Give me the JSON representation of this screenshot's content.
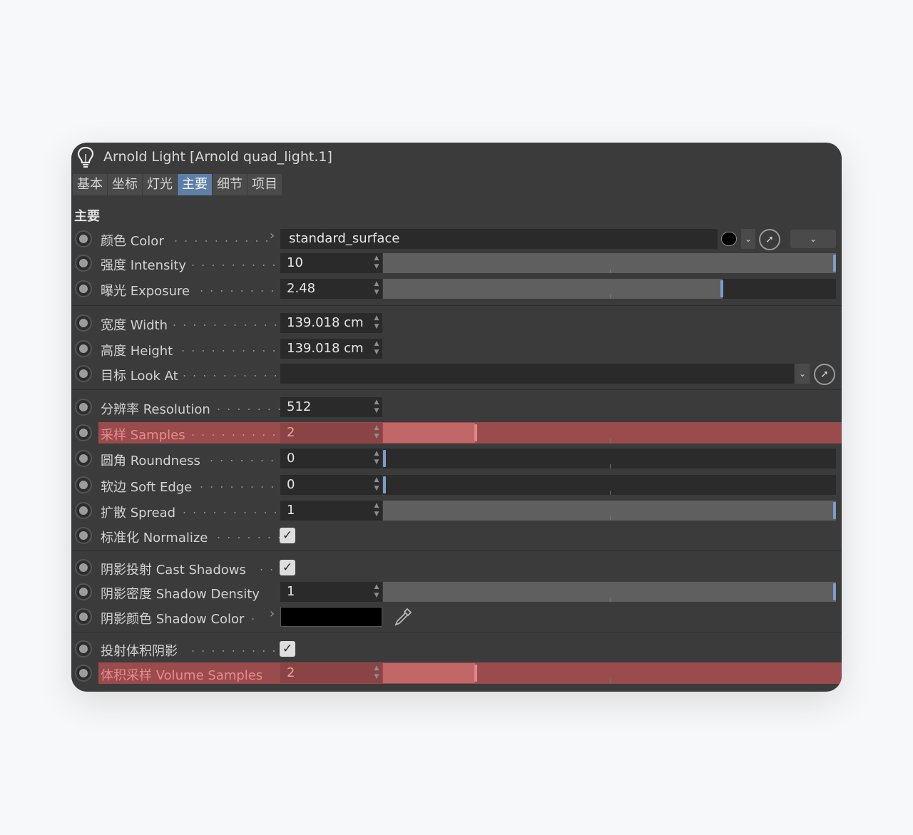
{
  "window": {
    "title": "Arnold Light [Arnold quad_light.1]",
    "icon": "lightbulb-icon"
  },
  "tabs": [
    {
      "label": "基本",
      "active": false
    },
    {
      "label": "坐标",
      "active": false
    },
    {
      "label": "灯光",
      "active": false
    },
    {
      "label": "主要",
      "active": true
    },
    {
      "label": "细节",
      "active": false
    },
    {
      "label": "项目",
      "active": false
    }
  ],
  "section": {
    "title": "主要"
  },
  "params": {
    "color": {
      "label": "颜色 Color",
      "dots": ". . . . . . . . . .",
      "value": "standard_surface",
      "swatch": "#000000"
    },
    "intensity": {
      "label": "强度 Intensity",
      "dots": ". . . . . . . . . .",
      "value": "10",
      "slider_fraction": 1.0
    },
    "exposure": {
      "label": "曝光 Exposure",
      "dots": ". . . . . . . . .",
      "value": "2.48",
      "slider_fraction": 0.75
    },
    "width": {
      "label": "宽度 Width",
      "dots": ". . . . . . . . . . . .",
      "value": "139.018 cm"
    },
    "height": {
      "label": "高度 Height",
      "dots": ". . . . . . . . . . .",
      "value": "139.018 cm"
    },
    "look_at": {
      "label": "目标 Look At",
      "dots": ". . . . . . . . . . .",
      "value": ""
    },
    "resolution": {
      "label": "分辨率 Resolution",
      "dots": ". . . . . . .",
      "value": "512"
    },
    "samples": {
      "label": "采样 Samples",
      "dots": ". . . . . . . . . .",
      "value": "2",
      "slider_fraction": 0.2
    },
    "roundness": {
      "label": "圆角 Roundness",
      "dots": ". . . . . . . .",
      "value": "0",
      "slider_fraction": 0.0
    },
    "soft_edge": {
      "label": "软边 Soft Edge",
      "dots": ". . . . . . . . .",
      "value": "0",
      "slider_fraction": 0.0
    },
    "spread": {
      "label": "扩散 Spread",
      "dots": ". . . . . . . . . . .",
      "value": "1",
      "slider_fraction": 1.0
    },
    "normalize": {
      "label": "标准化 Normalize",
      "dots": ". . . . . . .",
      "checked": true
    },
    "cast_shadows": {
      "label": "阴影投射 Cast Shadows",
      "dots": ". .",
      "checked": true
    },
    "shadow_density": {
      "label": "阴影密度 Shadow Density",
      "value": "1",
      "slider_fraction": 1.0
    },
    "shadow_color": {
      "label": "阴影颜色 Shadow Color",
      "dots": ".",
      "color": "#000000"
    },
    "cast_volumetric_shadows": {
      "label": "投射体积阴影",
      "dots": ". . . . . . . . . .",
      "checked": true
    },
    "volume_samples": {
      "label": "体积采样 Volume Samples",
      "value": "2",
      "slider_fraction": 0.2
    }
  },
  "colors": {
    "accent": "#5d7fa8",
    "highlight": "#9a4b4d",
    "panel": "#3b3b3b"
  }
}
